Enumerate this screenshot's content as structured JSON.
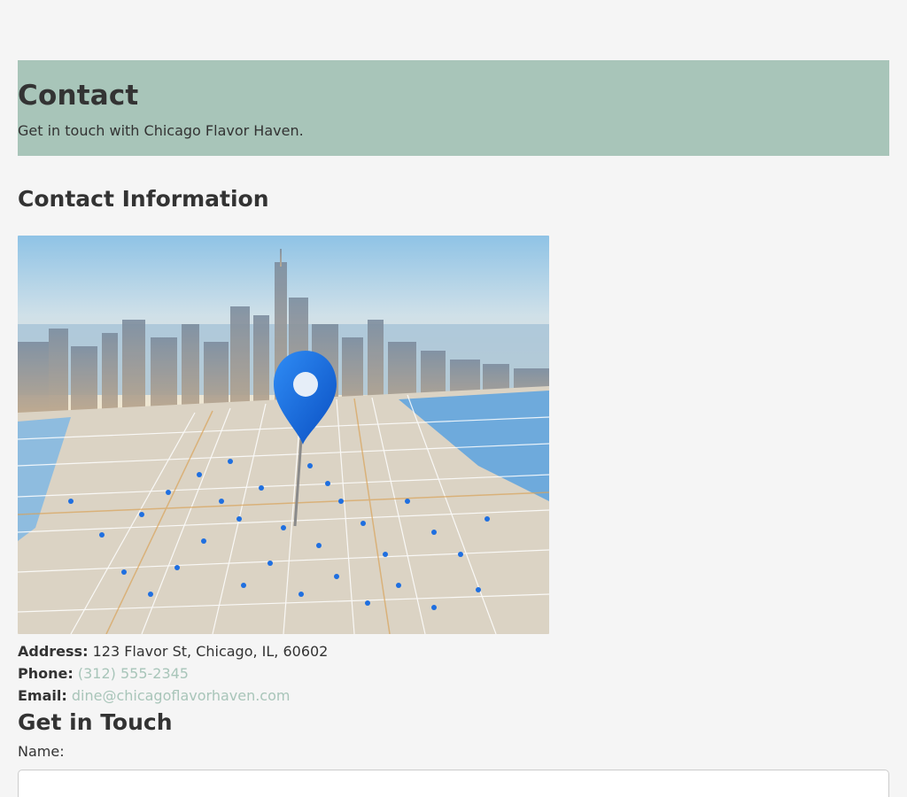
{
  "header": {
    "title": "Contact",
    "subtitle": "Get in touch with Chicago Flavor Haven."
  },
  "contact_info": {
    "title": "Contact Information",
    "map_image": "chicago-map-with-location-pin",
    "address_label": "Address:",
    "address_value": "123 Flavor St, Chicago, IL, 60602",
    "phone_label": "Phone:",
    "phone_value": "(312) 555-2345",
    "email_label": "Email:",
    "email_value": "dine@chicagoflavorhaven.com"
  },
  "form": {
    "title": "Get in Touch",
    "name_label": "Name:",
    "name_value": ""
  },
  "colors": {
    "page_bg": "#f5f5f5",
    "accent": "#a8c5b9",
    "text": "#333333"
  }
}
